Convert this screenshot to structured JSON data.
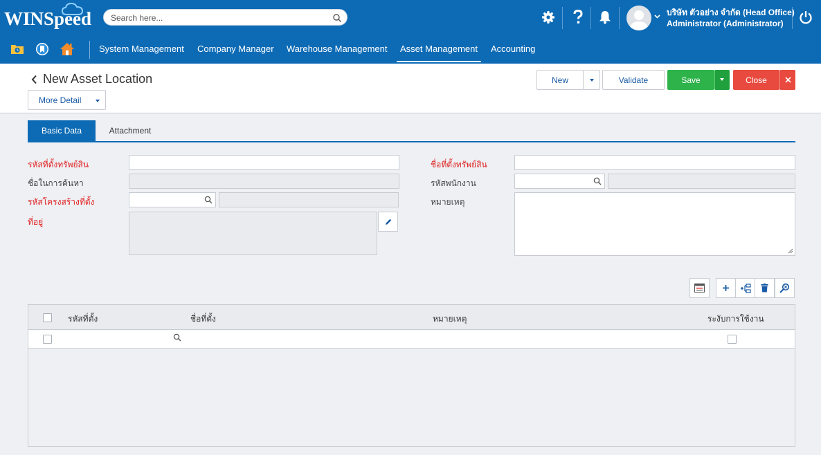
{
  "header": {
    "logo": "WINSpeed",
    "search_placeholder": "Search here...",
    "company_line": "บริษัท ตัวอย่าง จำกัด (Head Office)",
    "user_line": "Administrator (Administrator)"
  },
  "nav": {
    "items": [
      "System Management",
      "Company Manager",
      "Warehouse Management",
      "Asset Management",
      "Accounting"
    ],
    "active": "Asset Management"
  },
  "page": {
    "title": "New Asset Location",
    "more_detail": "More Detail",
    "buttons": {
      "new": "New",
      "validate": "Validate",
      "save": "Save",
      "close": "Close"
    }
  },
  "tabs": [
    "Basic Data",
    "Attachment"
  ],
  "form": {
    "location_code_label": "รหัสที่ตั้งทรัพย์สิน",
    "search_name_label": "ชื่อในการค้นหา",
    "structure_code_label": "รหัสโครงสร้างที่ตั้ง",
    "address_label": "ที่อยู่",
    "location_name_label": "ชื่อที่ตั้งทรัพย์สิน",
    "employee_code_label": "รหัสพนักงาน",
    "remark_label": "หมายเหตุ"
  },
  "grid": {
    "columns": [
      "รหัสที่ตั้ง",
      "ชื่อที่ตั้ง",
      "หมายเหตุ",
      "ระงับการใช้งาน"
    ]
  },
  "colors": {
    "brand": "#0d6bb5",
    "save": "#2eb34b",
    "close": "#e84a3f",
    "required": "#e02020"
  }
}
